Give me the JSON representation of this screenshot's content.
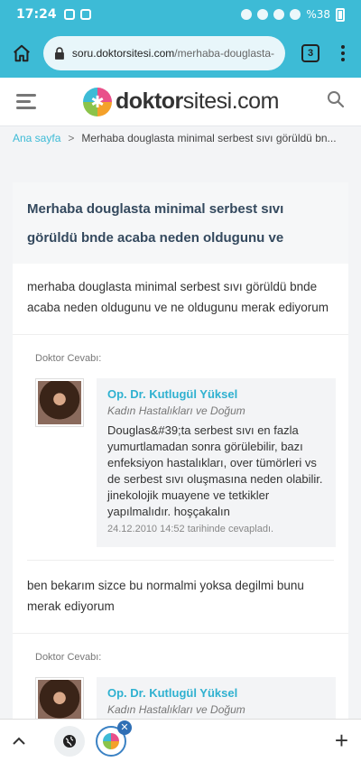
{
  "status": {
    "time": "17:24",
    "battery": "%38"
  },
  "browser": {
    "url_host": "soru.doktorsitesi.com",
    "url_path": "/merhaba-douglasta-",
    "tab_count": "3"
  },
  "site": {
    "logo_bold": "doktor",
    "logo_rest": "sitesi.com"
  },
  "breadcrumb": {
    "home": "Ana sayfa",
    "separator": ">",
    "current": "Merhaba douglasta minimal serbest sıvı görüldü bn..."
  },
  "question": {
    "title": "Merhaba douglasta minimal serbest sıvı görüldü bnde acaba neden oldugunu ve",
    "body": "merhaba douglasta minimal serbest sıvı görüldü bnde acaba neden oldugunu ve ne oldugunu merak ediyorum"
  },
  "answers": [
    {
      "label": "Doktor Cevabı:",
      "doctor": "Op. Dr. Kutlugül Yüksel",
      "specialty": "Kadın Hastalıkları ve Doğum",
      "text": "Douglas&#39;ta serbest sıvı en fazla yumurtlamadan sonra görülebilir, bazı enfeksiyon hastalıkları, over tümörleri vs de serbest sıvı oluşmasına neden olabilir. jinekolojik muayene ve tetkikler yapılmalıdır. hoşçakalın",
      "date": "24.12.2010 14:52 tarihinde cevapladı."
    },
    {
      "label": "Doktor Cevabı:",
      "doctor": "Op. Dr. Kutlugül Yüksel",
      "specialty": "Kadın Hastalıkları ve Doğum"
    }
  ],
  "followup": "ben bekarım sizce bu normalmi yoksa degilmi bunu merak ediyorum",
  "icons": {
    "home": "home-icon",
    "lock": "lock-icon",
    "menu": "more-vert-icon",
    "hamburger": "hamburger-icon",
    "search": "search-icon",
    "chevron": "chevron-up-icon",
    "plus": "plus-icon",
    "close": "close-icon"
  },
  "colors": {
    "accent": "#3dbbd6",
    "title": "#34495e",
    "doctor_name": "#2fb1d0"
  }
}
